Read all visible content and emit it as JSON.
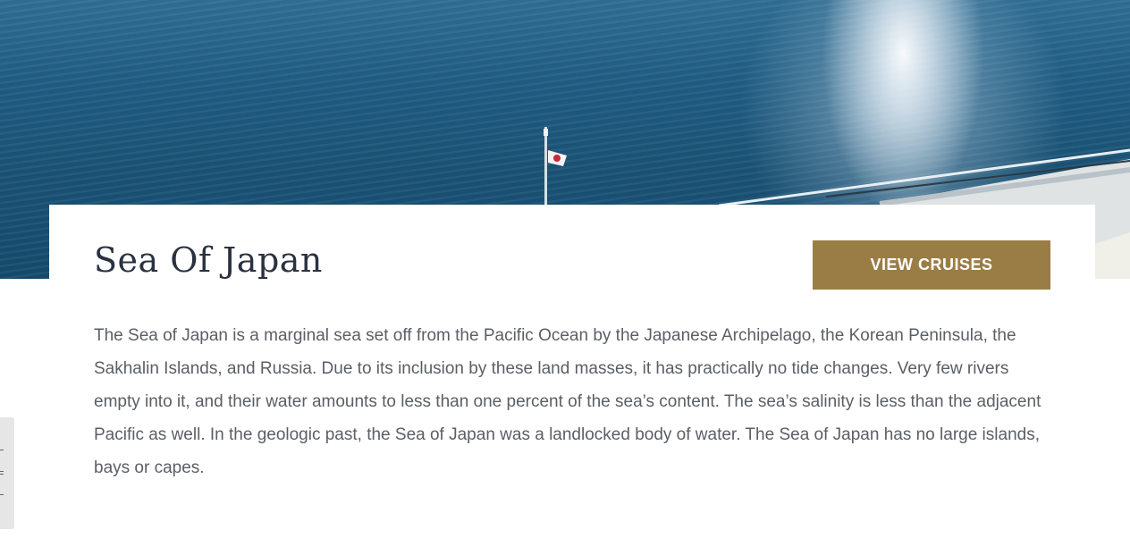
{
  "hero": {
    "scene_icon": "ocean-view-from-ship-deck"
  },
  "card": {
    "title": "Sea Of Japan",
    "cta_label": "VIEW CRUISES",
    "description": "The Sea of Japan is a marginal sea set off from the Pacific Ocean by the Japanese Archipelago, the Korean Peninsula, the Sakhalin Islands, and Russia. Due to its inclusion by these land masses, it has practically no tide changes. Very few rivers empty into it, and their water amounts to less than one percent of the sea’s content. The sea’s salinity is less than the adjacent Pacific as well. In the geologic past, the Sea of Japan was a landlocked body of water. The Sea of Japan has no large islands, bays or capes."
  },
  "side_tab": {
    "icon": "feedback-tab-icon"
  },
  "colors": {
    "cta_background": "#9a7d45",
    "title_text": "#2a3240",
    "body_text": "#5a5f66"
  }
}
